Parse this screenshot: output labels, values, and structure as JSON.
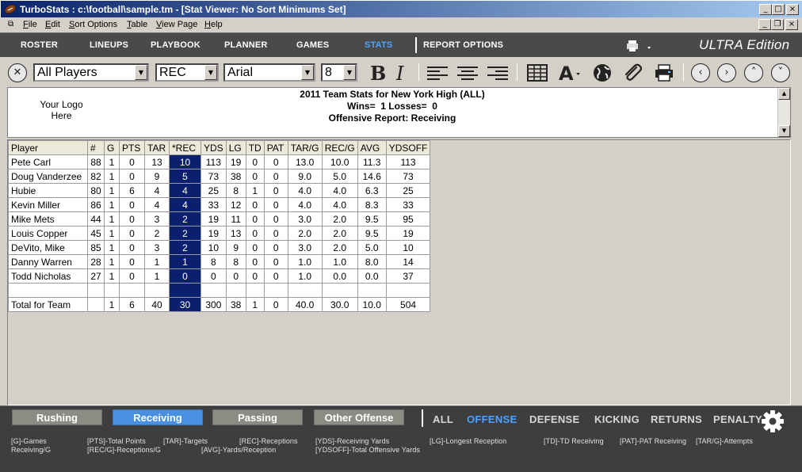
{
  "window": {
    "title": "TurboStats : c:\\football\\sample.tm - [Stat Viewer: No Sort Minimums Set]"
  },
  "menu": [
    "File",
    "Edit",
    "Sort Options",
    "Table",
    "View Page",
    "Help"
  ],
  "nav": {
    "items": [
      "ROSTER",
      "LINEUPS",
      "PLAYBOOK",
      "PLANNER",
      "GAMES",
      "STATS"
    ],
    "active": "STATS",
    "report_options": "REPORT OPTIONS",
    "edition": "ULTRA Edition"
  },
  "toolbar": {
    "players_filter": "All Players",
    "stat_column": "REC",
    "font_family": "Arial",
    "font_size": "8"
  },
  "report": {
    "logo_line1": "Your Logo",
    "logo_line2": "Here",
    "title": "2011 Team Stats for New York High (ALL)",
    "record": "Wins=  1 Losses=  0",
    "subtitle": "Offensive Report: Receiving"
  },
  "table": {
    "columns": [
      "Player",
      "#",
      "G",
      "PTS",
      "TAR",
      "*REC",
      "YDS",
      "LG",
      "TD",
      "PAT",
      "TAR/G",
      "REC/G",
      "AVG",
      "YDSOFF"
    ],
    "rows": [
      [
        "Pete Carl",
        "88",
        "1",
        "0",
        "13",
        "10",
        "113",
        "19",
        "0",
        "0",
        "13.0",
        "10.0",
        "11.3",
        "113"
      ],
      [
        "Doug Vanderzee",
        "82",
        "1",
        "0",
        "9",
        "5",
        "73",
        "38",
        "0",
        "0",
        "9.0",
        "5.0",
        "14.6",
        "73"
      ],
      [
        "Hubie",
        "80",
        "1",
        "6",
        "4",
        "4",
        "25",
        "8",
        "1",
        "0",
        "4.0",
        "4.0",
        "6.3",
        "25"
      ],
      [
        "Kevin Miller",
        "86",
        "1",
        "0",
        "4",
        "4",
        "33",
        "12",
        "0",
        "0",
        "4.0",
        "4.0",
        "8.3",
        "33"
      ],
      [
        "Mike Mets",
        "44",
        "1",
        "0",
        "3",
        "2",
        "19",
        "11",
        "0",
        "0",
        "3.0",
        "2.0",
        "9.5",
        "95"
      ],
      [
        "Louis Copper",
        "45",
        "1",
        "0",
        "2",
        "2",
        "19",
        "13",
        "0",
        "0",
        "2.0",
        "2.0",
        "9.5",
        "19"
      ],
      [
        "DeVito, Mike",
        "85",
        "1",
        "0",
        "3",
        "2",
        "10",
        "9",
        "0",
        "0",
        "3.0",
        "2.0",
        "5.0",
        "10"
      ],
      [
        "Danny Warren",
        "28",
        "1",
        "0",
        "1",
        "1",
        "8",
        "8",
        "0",
        "0",
        "1.0",
        "1.0",
        "8.0",
        "14"
      ],
      [
        "Todd Nicholas",
        "27",
        "1",
        "0",
        "1",
        "0",
        "0",
        "0",
        "0",
        "0",
        "1.0",
        "0.0",
        "0.0",
        "37"
      ],
      [
        "",
        "",
        "",
        "",
        "",
        "",
        "",
        "",
        "",
        "",
        "",
        "",
        "",
        ""
      ],
      [
        "Total for Team",
        "",
        "1",
        "6",
        "40",
        "30",
        "300",
        "38",
        "1",
        "0",
        "40.0",
        "30.0",
        "10.0",
        "504"
      ]
    ]
  },
  "categories": {
    "items": [
      "Rushing",
      "Receiving",
      "Passing",
      "Other Offense"
    ],
    "active": "Receiving"
  },
  "filters": {
    "items": [
      "ALL",
      "OFFENSE",
      "DEFENSE",
      "KICKING",
      "RETURNS",
      "PENALTY"
    ],
    "active": "OFFENSE"
  },
  "legend": {
    "g": "[G]-Games",
    "pts": "[PTS]-Total Points",
    "tar": "[TAR]-Targets",
    "rec": "[REC]-Receptions",
    "yds": "[YDS]-Receiving Yards",
    "lg": "[LG]-Longest Reception",
    "td": "[TD]-TD Receiving",
    "pat": "[PAT]-PAT Receiving",
    "targ": "[TAR/G]-Attempts",
    "targ_cont": "Receiving/G",
    "recg": "[REC/G]-Receptions/G",
    "avg": "[AVG]-Yards/Reception",
    "ydsoff": "[YDSOFF]-Total Offensive Yards"
  },
  "colors": {
    "accent": "#4da3ff",
    "selected_column": "#0a1f6e",
    "active_category": "#4a90e2"
  }
}
